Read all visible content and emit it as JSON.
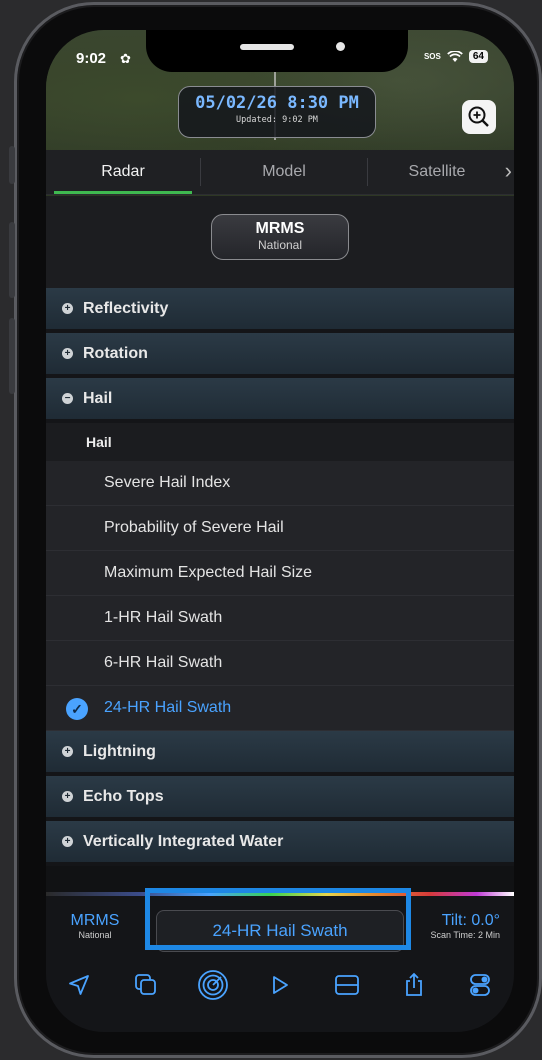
{
  "status": {
    "time": "9:02",
    "sos": "SOS",
    "battery": "64"
  },
  "timestamp": {
    "main": "05/02/26 8:30 PM",
    "updated": "Updated: 9:02 PM"
  },
  "tabs": [
    {
      "label": "Radar",
      "active": true
    },
    {
      "label": "Model",
      "active": false
    },
    {
      "label": "Satellite",
      "active": false
    }
  ],
  "product": {
    "name": "MRMS",
    "scope": "National"
  },
  "categories": {
    "reflectivity": "Reflectivity",
    "rotation": "Rotation",
    "hail": "Hail",
    "lightning": "Lightning",
    "echo_tops": "Echo Tops",
    "vil": "Vertically Integrated Water"
  },
  "hail_group": {
    "header": "Hail",
    "items": [
      "Severe Hail Index",
      "Probability of Severe Hail",
      "Maximum Expected Hail Size",
      "1-HR Hail Swath",
      "6-HR Hail Swath",
      "24-HR Hail Swath"
    ],
    "selected_index": 5
  },
  "bottom_bar": {
    "left_title": "MRMS",
    "left_sub": "National",
    "center_label": "24-HR Hail Swath",
    "tilt": "Tilt: 0.0°",
    "scan_time": "Scan Time: 2 Min"
  },
  "toolbar_icons": [
    "location-arrow-icon",
    "layers-icon",
    "radar-icon",
    "play-icon",
    "split-view-icon",
    "share-icon",
    "toggles-icon"
  ],
  "colors": {
    "accent": "#4aa3ff",
    "active_tab": "#3fb950",
    "highlight": "#1e88e5"
  }
}
